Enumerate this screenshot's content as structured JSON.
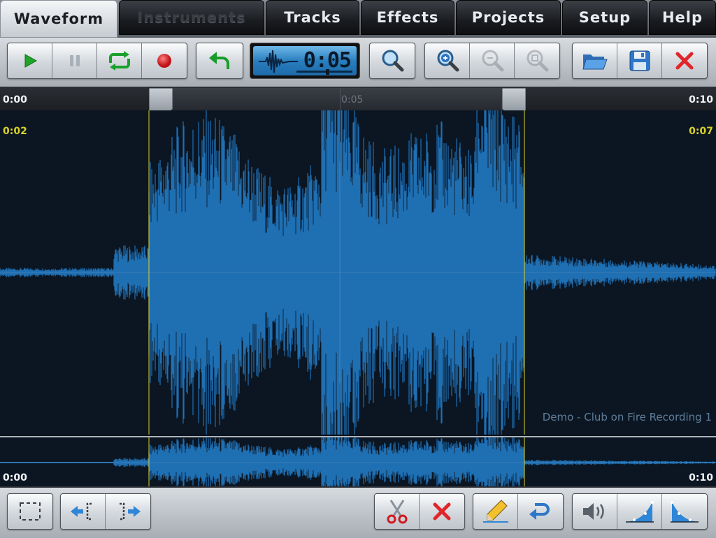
{
  "tabs": [
    {
      "label": "Waveform",
      "state": "active"
    },
    {
      "label": "Instruments",
      "state": "disabled"
    },
    {
      "label": "Tracks",
      "state": "normal"
    },
    {
      "label": "Effects",
      "state": "normal"
    },
    {
      "label": "Projects",
      "state": "normal"
    },
    {
      "label": "Setup",
      "state": "normal"
    },
    {
      "label": "Help",
      "state": "normal"
    }
  ],
  "timer": {
    "value": "0:05"
  },
  "ruler": {
    "start": "0:00",
    "mid": "0:05",
    "end": "0:10"
  },
  "selection": {
    "start_label": "0:02",
    "end_label": "0:07",
    "color": "#d9d22a"
  },
  "overview": {
    "start": "0:00",
    "end": "0:10"
  },
  "track": {
    "name": "Demo - Club on Fire Recording 1"
  },
  "colors": {
    "waveform": "#1f6fb3",
    "accent": "#3a8fd6",
    "record": "#e0262a",
    "play": "#1fa52a"
  },
  "toolbar_icons": [
    "play-icon",
    "pause-icon",
    "loop-icon",
    "record-icon",
    "undo-icon",
    "zoom-icon",
    "zoom-in-icon",
    "zoom-out-icon",
    "zoom-fit-icon",
    "folder-icon",
    "save-icon",
    "close-icon"
  ],
  "bottom_icons": [
    "select-all-icon",
    "move-left-marker-icon",
    "move-right-marker-icon",
    "cut-icon",
    "delete-icon",
    "pencil-icon",
    "redo-icon",
    "volume-icon",
    "fade-in-icon",
    "fade-out-icon"
  ]
}
